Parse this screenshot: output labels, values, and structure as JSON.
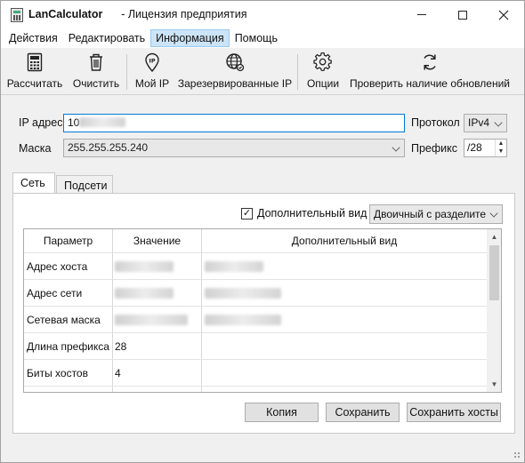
{
  "window": {
    "app_name": "LanCalculator",
    "license": "- Лицензия предприятия"
  },
  "menu": [
    "Действия",
    "Редактировать",
    "Информация",
    "Помощь"
  ],
  "toolbar": {
    "calculate": "Рассчитать",
    "clear": "Очистить",
    "my_ip": "Мой IP",
    "reserved_ip": "Зарезервированные IP",
    "options": "Опции",
    "check_updates": "Проверить наличие обновлений"
  },
  "form": {
    "ip_label": "IP адрес",
    "ip_value": "10",
    "protocol_label": "Протокол",
    "protocol_value": "IPv4",
    "mask_label": "Маска",
    "mask_value": "255.255.255.240",
    "prefix_label": "Префикс",
    "prefix_value": "/28"
  },
  "tabs": [
    "Сеть",
    "Подсети"
  ],
  "options": {
    "extra_view_label": "Дополнительный вид",
    "extra_view_checked": true,
    "view_mode": "Двоичный с разделите"
  },
  "table": {
    "headers": [
      "Параметр",
      "Значение",
      "Дополнительный вид"
    ],
    "rows": [
      {
        "param": "Адрес хоста",
        "value": "",
        "extra": ""
      },
      {
        "param": "Адрес сети",
        "value": "",
        "extra": ""
      },
      {
        "param": "Сетевая маска",
        "value": "",
        "extra": ""
      },
      {
        "param": "Длина префикса",
        "value": "28",
        "extra": ""
      },
      {
        "param": "Биты хостов",
        "value": "4",
        "extra": ""
      }
    ]
  },
  "buttons": {
    "copy": "Копия",
    "save": "Сохранить",
    "save_hosts": "Сохранить хосты"
  },
  "icons": [
    "calculator-icon",
    "trash-icon",
    "location-pin-icon",
    "globe-icon",
    "gear-icon",
    "refresh-icon"
  ]
}
